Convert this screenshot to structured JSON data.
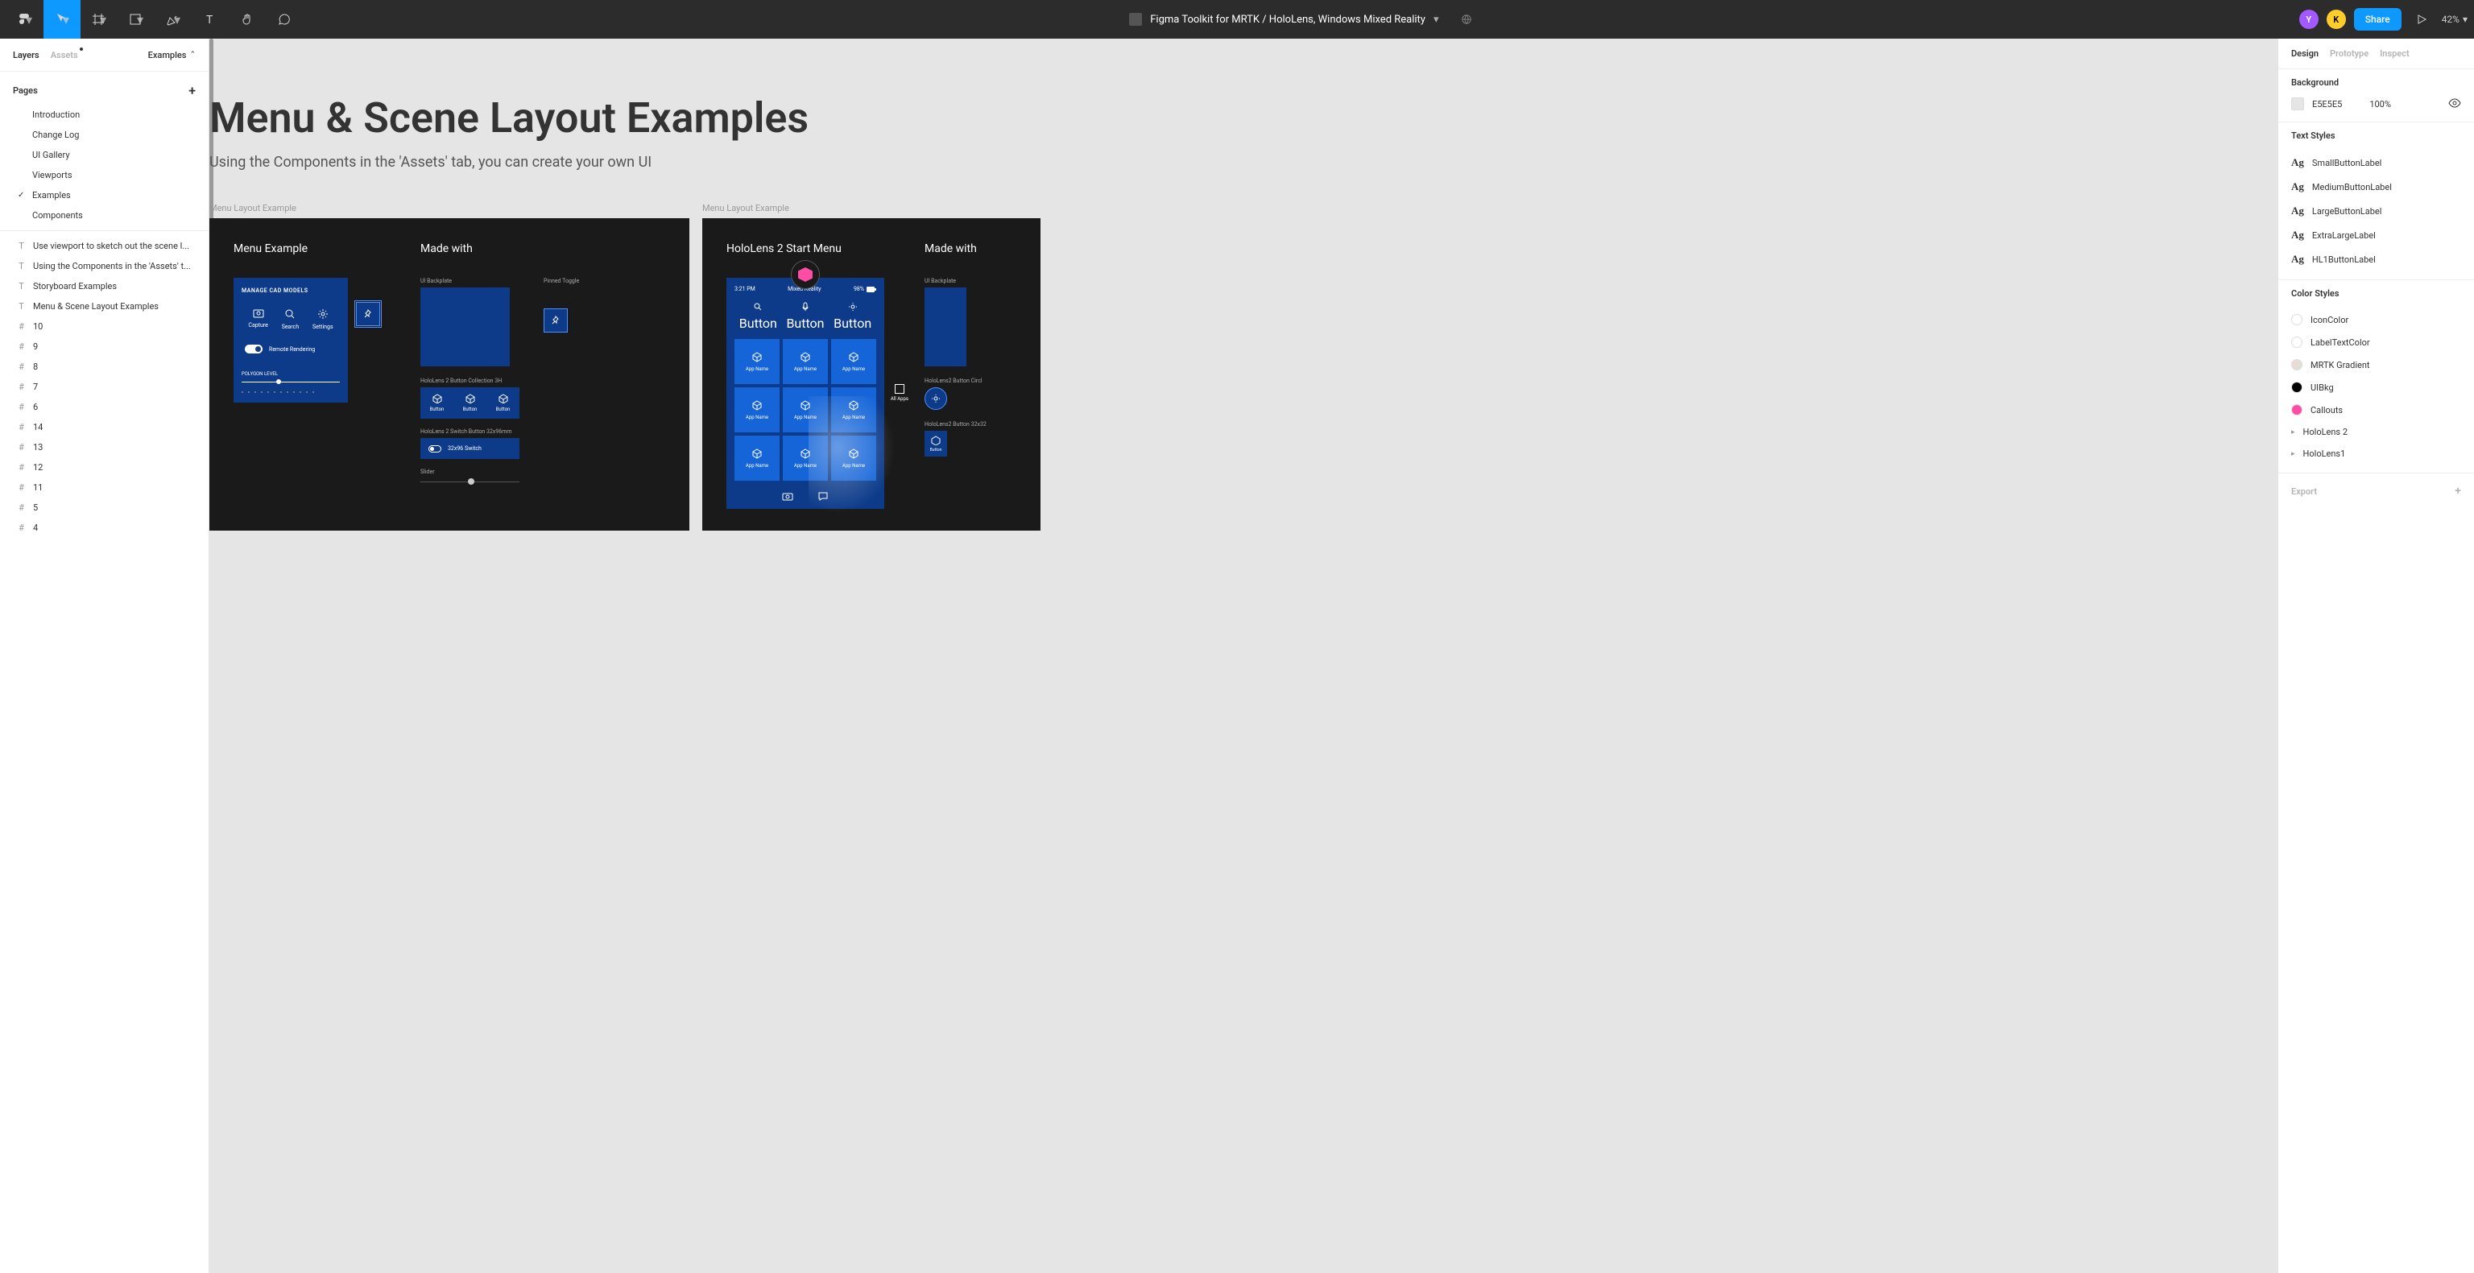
{
  "toolbar": {
    "title": "Figma Toolkit for MRTK / HoloLens, Windows Mixed Reality",
    "share": "Share",
    "zoom": "42%",
    "avatars": [
      "Y",
      "K"
    ]
  },
  "leftPanel": {
    "tabs": {
      "layers": "Layers",
      "assets": "Assets"
    },
    "dropdown": "Examples",
    "pagesHeader": "Pages",
    "pages": [
      "Introduction",
      "Change Log",
      "UI Gallery",
      "Viewports",
      "Examples",
      "Components"
    ],
    "checkedPage": "Examples",
    "layers": [
      {
        "icon": "T",
        "text": "Use viewport to sketch out the scene l..."
      },
      {
        "icon": "T",
        "text": "Using the Components in the 'Assets' t..."
      },
      {
        "icon": "T",
        "text": "Storyboard Examples"
      },
      {
        "icon": "T",
        "text": "Menu & Scene Layout Examples"
      },
      {
        "icon": "#",
        "text": "10"
      },
      {
        "icon": "#",
        "text": "9"
      },
      {
        "icon": "#",
        "text": "8"
      },
      {
        "icon": "#",
        "text": "7"
      },
      {
        "icon": "#",
        "text": "6"
      },
      {
        "icon": "#",
        "text": "14"
      },
      {
        "icon": "#",
        "text": "13"
      },
      {
        "icon": "#",
        "text": "12"
      },
      {
        "icon": "#",
        "text": "11"
      },
      {
        "icon": "#",
        "text": "5"
      },
      {
        "icon": "#",
        "text": "4"
      }
    ]
  },
  "canvas": {
    "heading": "Menu & Scene Layout Examples",
    "subheading": "Using the Components in the 'Assets' tab, you can create your own UI",
    "frameLabel1": "Menu Layout Example",
    "frameLabel2": "Menu Layout Example",
    "menuExample": {
      "title": "Menu Example",
      "header": "MANAGE CAD MODELS",
      "items": [
        "Capture",
        "Search",
        "Settings"
      ],
      "toggleLabel": "Remote Rendering",
      "polygonLabel": "POLYGON LEVEL"
    },
    "madeWith": {
      "title": "Made with",
      "backplate": "UI Backplate",
      "pinned": "Pinned Toggle",
      "btnCol": "HoloLens 2 Button Collection 3H",
      "buttons": [
        "Button",
        "Button",
        "Button"
      ],
      "switchLbl": "HoloLens 2 Switch Button 32x96mm",
      "switchText": "32x96 Switch",
      "sliderLbl": "Slider"
    },
    "hololens": {
      "title": "HoloLens 2 Start Menu",
      "time": "3:21 PM",
      "center": "Mixed Reality",
      "battery": "98%",
      "topRow": [
        "Button",
        "Button",
        "Button"
      ],
      "tile": "App Name",
      "allApps": "All Apps",
      "made2": "Made with",
      "bp2": "UI Backplate",
      "circBtn": "HoloLens2 Button Circl",
      "sqBtn": "HoloLens2 Button 32x32",
      "sqBtnLbl": "Button"
    }
  },
  "rightPanel": {
    "tabs": {
      "design": "Design",
      "prototype": "Prototype",
      "inspect": "Inspect"
    },
    "background": {
      "label": "Background",
      "color": "E5E5E5",
      "opacity": "100%"
    },
    "textStyles": {
      "label": "Text Styles",
      "items": [
        "SmallButtonLabel",
        "MediumButtonLabel",
        "LargeButtonLabel",
        "ExtraLargeLabel",
        "HL1ButtonLabel"
      ]
    },
    "colorStyles": {
      "label": "Color Styles",
      "items": [
        {
          "name": "IconColor",
          "cls": "white"
        },
        {
          "name": "LabelTextColor",
          "cls": "white"
        },
        {
          "name": "MRTK Gradient",
          "cls": "grad"
        },
        {
          "name": "UIBkg",
          "cls": "black"
        },
        {
          "name": "Callouts",
          "cls": "pink"
        }
      ],
      "groups": [
        "HoloLens 2",
        "HoloLens1"
      ]
    },
    "export": "Export"
  }
}
